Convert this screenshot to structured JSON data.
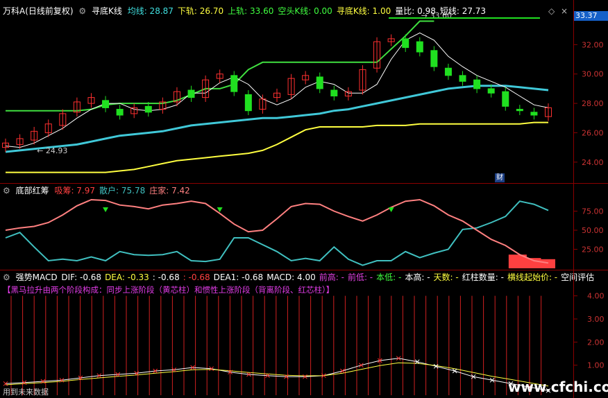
{
  "panel1": {
    "title": "万科A(日线前复权)",
    "indicator_name": "寻底K线",
    "fields": [
      {
        "label": "均线: 28.87",
        "color": "#40e0e0"
      },
      {
        "label": "下轨: 26.70",
        "color": "#ffff40"
      },
      {
        "label": "上轨: 33.60",
        "color": "#40ff40"
      },
      {
        "label": "空头K线: 0.00",
        "color": "#40ff40"
      },
      {
        "label": "寻底K线: 1.00",
        "color": "#ffff40"
      },
      {
        "label": "量比: 0.98",
        "color": "#ffffff"
      },
      {
        "label": "短线: 27.73",
        "color": "#ffffff"
      }
    ],
    "price_tag": "33.37",
    "y_ticks": [
      "32.00",
      "30.00",
      "28.00",
      "26.00",
      "24.00"
    ],
    "annotations": {
      "low": "24.93",
      "high": "33.60"
    },
    "cai_label": "财"
  },
  "panel2": {
    "indicator_name": "底部红筹",
    "fields": [
      {
        "label": "吸筹: 7.97",
        "color": "#ff4040"
      },
      {
        "label": "散户: 75.78",
        "color": "#40c0c0"
      },
      {
        "label": "庄家: 7.42",
        "color": "#ff8080"
      }
    ],
    "y_ticks": [
      "75.00",
      "50.00",
      "25.00"
    ]
  },
  "panel3": {
    "indicator_name": "强势MACD",
    "fields": [
      {
        "label": "DIF: -0.68",
        "color": "#ffffff"
      },
      {
        "label": "DEA: -0.33",
        "color": "#ffff40"
      },
      {
        "label": ": -0.68",
        "color": "#ffffff"
      },
      {
        "label": ": -0.68",
        "color": "#ff4040"
      },
      {
        "label": "DEA1: -0.68",
        "color": "#ffffff"
      },
      {
        "label": "MACD: 4.00",
        "color": "#ffffff"
      },
      {
        "label": "前高: -",
        "color": "#e040e0"
      },
      {
        "label": "前低: -",
        "color": "#e040e0"
      },
      {
        "label": "本低: -",
        "color": "#40ff40"
      },
      {
        "label": "本高: -",
        "color": "#ffffff"
      },
      {
        "label": "天数: -",
        "color": "#ffff40"
      },
      {
        "label": "红柱数量: -",
        "color": "#ffffff"
      },
      {
        "label": "横线起始价: -",
        "color": "#ffff40"
      },
      {
        "label": "空间评估",
        "color": "#ffffff"
      }
    ],
    "note": "【黑马拉升由两个阶段构成：同步上涨阶段（黄芯柱）和惯性上涨阶段（背离阶段、红芯柱）】",
    "y_ticks": [
      "4.00",
      "3.00",
      "2.00",
      "1.00"
    ],
    "footer": "用到未来数据",
    "watermark": "www.cfchi.com"
  },
  "chart_data": [
    {
      "type": "line",
      "title": "万科A(日线前复权) 寻底K线",
      "ylim": [
        23,
        34
      ],
      "series": [
        {
          "name": "均线",
          "color": "#40c8d8",
          "values": [
            24.7,
            24.8,
            24.9,
            25.0,
            25.1,
            25.2,
            25.4,
            25.6,
            25.8,
            25.9,
            26.0,
            26.1,
            26.3,
            26.5,
            26.6,
            26.7,
            26.8,
            26.9,
            27.0,
            27.0,
            27.1,
            27.2,
            27.3,
            27.5,
            27.6,
            27.8,
            28.0,
            28.2,
            28.4,
            28.6,
            28.8,
            29.0,
            29.1,
            29.2,
            29.2,
            29.2,
            29.1,
            29.0,
            28.9
          ]
        },
        {
          "name": "下轨",
          "color": "#ffff40",
          "values": [
            23.3,
            23.3,
            23.3,
            23.3,
            23.3,
            23.3,
            23.3,
            23.3,
            23.4,
            23.5,
            23.7,
            23.9,
            24.1,
            24.2,
            24.3,
            24.4,
            24.5,
            24.6,
            24.8,
            25.2,
            25.7,
            26.2,
            26.4,
            26.4,
            26.4,
            26.4,
            26.5,
            26.5,
            26.5,
            26.6,
            26.6,
            26.6,
            26.6,
            26.6,
            26.6,
            26.6,
            26.6,
            26.7,
            26.7
          ]
        },
        {
          "name": "上轨",
          "color": "#40e040",
          "values": [
            27.5,
            27.5,
            27.5,
            27.5,
            27.5,
            27.5,
            27.6,
            27.9,
            28.0,
            28.0,
            28.0,
            28.0,
            28.2,
            28.6,
            29.0,
            29.0,
            29.3,
            30.3,
            30.8,
            30.8,
            30.8,
            30.8,
            30.8,
            30.8,
            30.8,
            30.8,
            30.8,
            31.7,
            32.6,
            33.6,
            33.6
          ]
        },
        {
          "name": "短线",
          "color": "#ffffff",
          "values": [
            25.1,
            25.0,
            25.3,
            25.8,
            26.3,
            27.0,
            27.6,
            28.0,
            28.0,
            27.6,
            27.5,
            27.6,
            27.9,
            28.7,
            28.7,
            29.4,
            29.8,
            29.3,
            28.3,
            27.9,
            28.3,
            29.1,
            29.5,
            29.3,
            28.7,
            28.7,
            29.3,
            31.0,
            32.3,
            32.8,
            32.3,
            31.2,
            30.5,
            29.9,
            29.5,
            29.1,
            28.5,
            27.9,
            27.7
          ]
        }
      ],
      "candles": {
        "open": [
          25.0,
          25.2,
          25.5,
          26.0,
          26.5,
          27.4,
          28.0,
          28.2,
          27.6,
          27.3,
          27.8,
          27.6,
          28.1,
          28.9,
          28.4,
          29.7,
          29.9,
          28.6,
          27.6,
          28.4,
          28.6,
          29.6,
          29.8,
          28.9,
          28.5,
          28.9,
          30.4,
          32.2,
          32.4,
          32.2,
          31.6,
          30.4,
          29.9,
          29.6,
          29.0,
          28.8,
          27.6,
          27.4,
          27.1
        ],
        "close": [
          25.3,
          25.6,
          26.1,
          26.6,
          27.3,
          28.1,
          28.4,
          27.7,
          27.2,
          27.7,
          27.4,
          28.1,
          28.8,
          28.4,
          29.6,
          30.0,
          28.8,
          27.5,
          28.3,
          28.7,
          29.7,
          29.9,
          29.0,
          28.5,
          28.8,
          30.3,
          32.2,
          32.4,
          31.8,
          31.5,
          30.5,
          29.9,
          29.5,
          29.0,
          28.7,
          27.8,
          27.5,
          27.2,
          27.7
        ]
      }
    },
    {
      "type": "line",
      "title": "底部红筹",
      "ylim": [
        0,
        100
      ],
      "series": [
        {
          "name": "吸筹",
          "color": "#ff4040",
          "values": [
            0,
            0,
            0,
            0,
            0,
            0,
            0,
            0,
            0,
            0,
            0,
            0,
            0,
            0,
            0,
            0,
            0,
            0,
            0,
            0,
            0,
            0,
            0,
            0,
            0,
            0,
            0,
            0,
            0,
            0,
            0,
            0,
            0,
            0,
            0,
            0,
            12,
            9,
            8
          ]
        },
        {
          "name": "散户",
          "color": "#40c0c0",
          "values": [
            40,
            47,
            28,
            10,
            12,
            10,
            15,
            10,
            22,
            18,
            17,
            18,
            22,
            10,
            9,
            12,
            40,
            40,
            31,
            22,
            10,
            13,
            10,
            28,
            12,
            4,
            10,
            10,
            22,
            14,
            20,
            25,
            51,
            53,
            60,
            68,
            88,
            84,
            76
          ]
        },
        {
          "name": "庄家",
          "color": "#ff8080",
          "values": [
            50,
            53,
            55,
            60,
            70,
            82,
            90,
            89,
            83,
            81,
            78,
            83,
            85,
            88,
            85,
            72,
            58,
            48,
            50,
            65,
            81,
            85,
            84,
            75,
            68,
            62,
            70,
            80,
            88,
            90,
            82,
            70,
            62,
            50,
            38,
            30,
            18,
            10,
            7
          ]
        }
      ]
    },
    {
      "type": "line",
      "title": "强势MACD",
      "ylim": [
        0,
        4.5
      ],
      "series": [
        {
          "name": "DIF",
          "color": "#ffffff",
          "values": [
            0.2,
            0.25,
            0.3,
            0.35,
            0.45,
            0.55,
            0.6,
            0.65,
            0.75,
            0.8,
            0.9,
            0.85,
            0.7,
            0.6,
            0.55,
            0.5,
            0.5,
            0.55,
            0.75,
            1.0,
            1.2,
            1.3,
            1.15,
            0.95,
            0.75,
            0.5,
            0.35,
            0.2,
            0.05,
            -0.1
          ]
        },
        {
          "name": "DEA",
          "color": "#ffff40",
          "values": [
            0.15,
            0.2,
            0.25,
            0.3,
            0.38,
            0.45,
            0.52,
            0.58,
            0.65,
            0.72,
            0.8,
            0.82,
            0.76,
            0.68,
            0.62,
            0.56,
            0.54,
            0.55,
            0.65,
            0.82,
            0.98,
            1.1,
            1.08,
            0.98,
            0.85,
            0.68,
            0.52,
            0.38,
            0.24,
            0.1
          ]
        }
      ]
    }
  ]
}
